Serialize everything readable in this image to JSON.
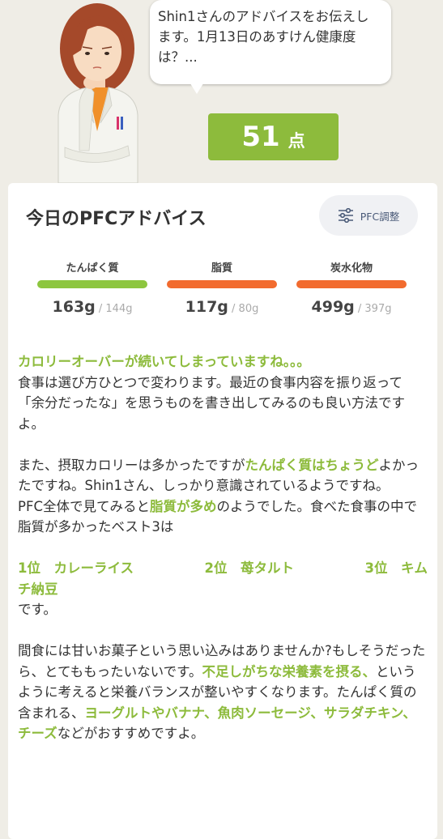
{
  "advisor_bubble": {
    "text": "Shin1さんのアドバイスをお伝えします。1月13日のあすけん健康度は？..."
  },
  "score": {
    "value": "51",
    "unit": "点"
  },
  "card": {
    "title": "今日のPFCアドバイス",
    "pfc_button_label": "PFC調整"
  },
  "macros": [
    {
      "label": "たんぱく質",
      "value": "163g",
      "target": " / 144g",
      "bar_color": "#8dc63f"
    },
    {
      "label": "脂質",
      "value": "117g",
      "target": " / 80g",
      "bar_color": "#f26b2e"
    },
    {
      "label": "炭水化物",
      "value": "499g",
      "target": " / 397g",
      "bar_color": "#f26b2e"
    }
  ],
  "advice": {
    "p1_headline": "カロリーオーバーが続いてしまっていますね。。。",
    "p1_body": "食事は選び方ひとつで変わります。最近の食事内容を振り返って「余分だったな」を思うものを書き出してみるのも良い方法ですよ。",
    "p2_a": "また、摂取カロリーは多かったですが",
    "p2_hl1": "たんぱく質はちょうど",
    "p2_b": "よかったですね。Shin1さん、しっかり意識されているようですね。",
    "p2_c": "PFC全体で見てみると",
    "p2_hl2": "脂質が多め",
    "p2_d": "のようでした。食べた食事の中で脂質が多かったベスト3は",
    "rank1": "1位　カレーライス",
    "rank2": "2位　苺タルト",
    "rank3": "3位　キム",
    "rank3_cont": "チ納豆",
    "p3_end": "です。",
    "p4_a": "間食には甘いお菓子という思い込みはありませんか?もしそうだったら、とてももったいないです。",
    "p4_hl1": "不足しがちな栄養素を摂る、",
    "p4_b": "というように考えると栄養バランスが整いやすくなります。たんぱく質の含まれる、",
    "p4_hl2": "ヨーグルトやバナナ、魚肉ソーセージ、サラダチキン、チーズ",
    "p4_c": "などがおすすめですよ。"
  },
  "colors": {
    "accent_green": "#8dbb3c",
    "over_orange": "#f26b2e",
    "background": "#efede6"
  }
}
